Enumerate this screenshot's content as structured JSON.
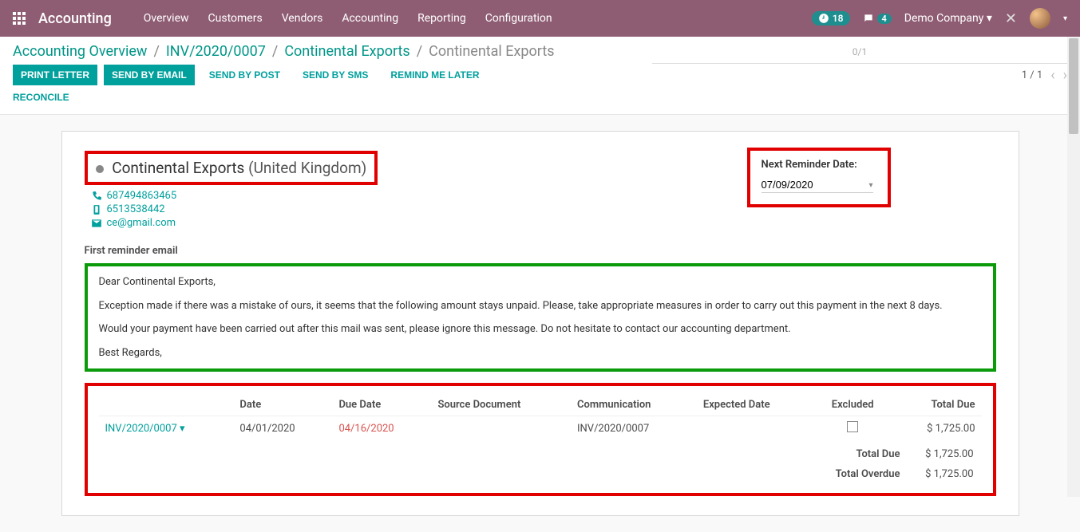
{
  "topbar": {
    "brand": "Accounting",
    "nav": [
      "Overview",
      "Customers",
      "Vendors",
      "Accounting",
      "Reporting",
      "Configuration"
    ],
    "clock_badge": "18",
    "msg_badge": "4",
    "company": "Demo Company"
  },
  "breadcrumb": {
    "items": [
      "Accounting Overview",
      "INV/2020/0007",
      "Continental Exports"
    ],
    "current": "Continental Exports"
  },
  "search": {
    "count": "0/1"
  },
  "actions": {
    "print_letter": "PRINT LETTER",
    "send_email": "SEND BY EMAIL",
    "send_post": "SEND BY POST",
    "send_sms": "SEND BY SMS",
    "remind_later": "REMIND ME LATER",
    "reconcile": "RECONCILE"
  },
  "pager": {
    "text": "1 / 1"
  },
  "customer": {
    "name": "Continental Exports",
    "country": "(United Kingdom)",
    "phone": "687494863465",
    "mobile": "6513538442",
    "email": "ce@gmail.com"
  },
  "reminder": {
    "label": "Next Reminder Date:",
    "value": "07/09/2020"
  },
  "section_title": "First reminder email",
  "email": {
    "greeting": "Dear Continental Exports,",
    "p1": "Exception made if there was a mistake of ours, it seems that the following amount stays unpaid. Please, take appropriate measures in order to carry out this payment in the next 8 days.",
    "p2": "Would your payment have been carried out after this mail was sent, please ignore this message. Do not hesitate to contact our accounting department.",
    "signoff": "Best Regards,"
  },
  "table": {
    "headers": {
      "invoice": "",
      "date": "Date",
      "due_date": "Due Date",
      "source": "Source Document",
      "comm": "Communication",
      "expected": "Expected Date",
      "excluded": "Excluded",
      "total_due": "Total Due"
    },
    "row": {
      "invoice": "INV/2020/0007",
      "date": "04/01/2020",
      "due_date": "04/16/2020",
      "source": "",
      "comm": "INV/2020/0007",
      "expected": "",
      "total_due": "$ 1,725.00"
    },
    "totals": {
      "total_due_label": "Total Due",
      "total_due_val": "$ 1,725.00",
      "total_overdue_label": "Total Overdue",
      "total_overdue_val": "$ 1,725.00"
    }
  }
}
